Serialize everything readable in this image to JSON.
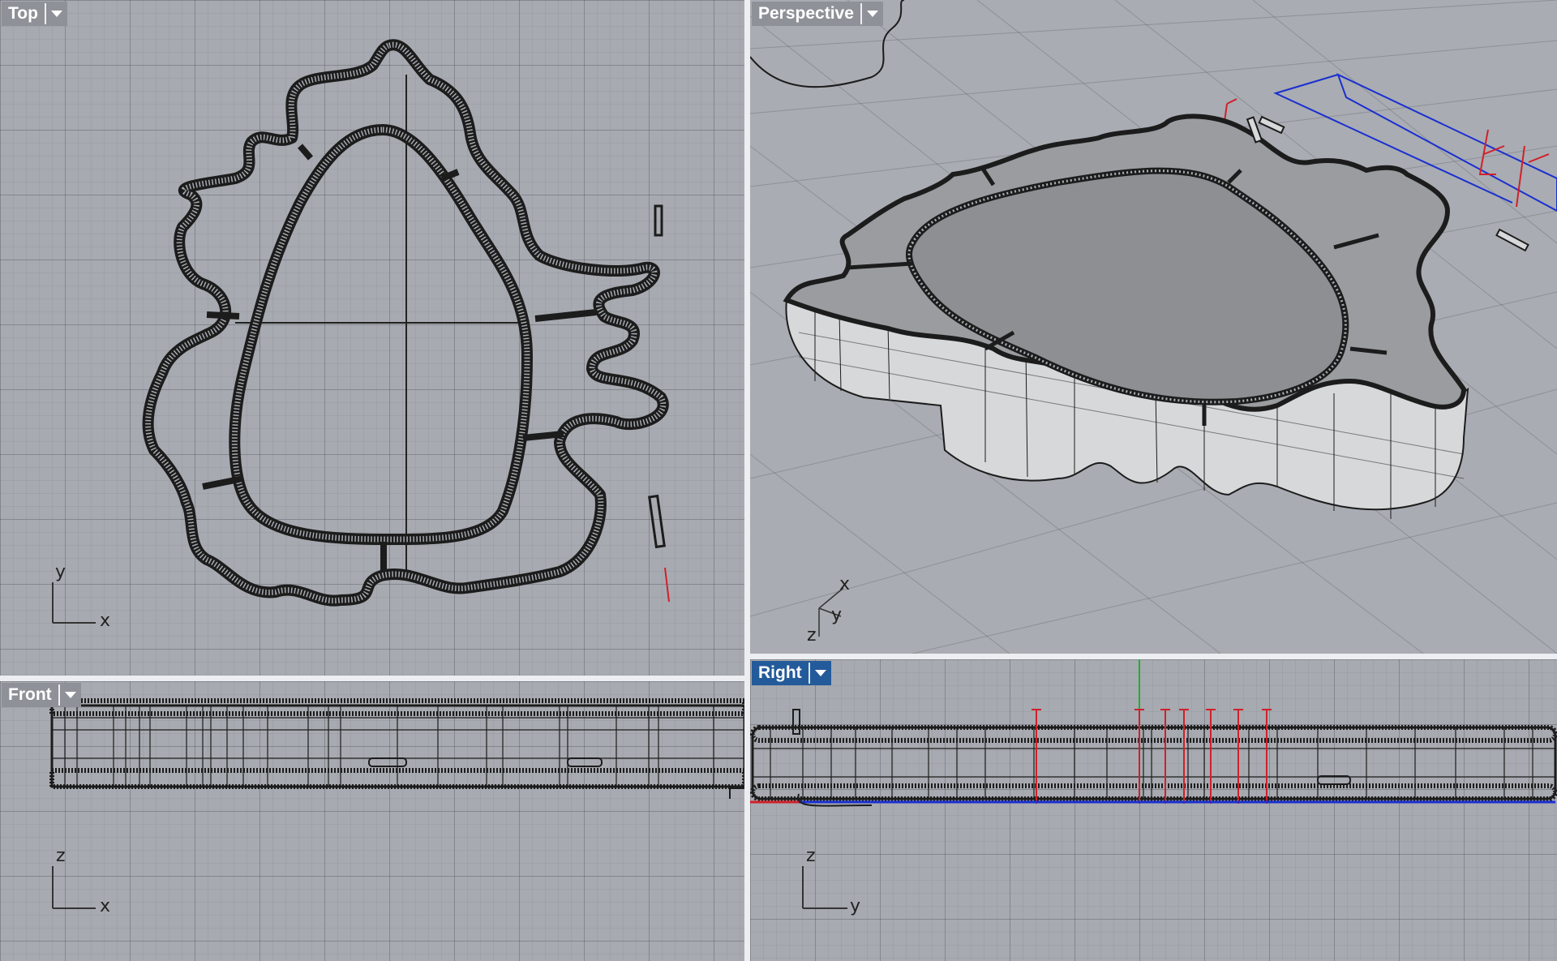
{
  "viewports": {
    "top": {
      "label": "Top",
      "axis_h": "x",
      "axis_v": "y"
    },
    "persp": {
      "label": "Perspective",
      "axis_x": "x",
      "axis_y": "y",
      "axis_z": "z"
    },
    "front": {
      "label": "Front",
      "axis_h": "x",
      "axis_v": "z"
    },
    "right": {
      "label": "Right",
      "axis_h": "y",
      "axis_v": "z",
      "active": true
    }
  },
  "colors": {
    "viewport_bg": "#a7aab0",
    "active_tab": "#235a9a",
    "inactive_tab": "#8e9197",
    "wire": "#1c1c1c",
    "selection_red": "#d0202a",
    "guide_blue": "#1a2fd0",
    "axis_green": "#1fb030"
  }
}
